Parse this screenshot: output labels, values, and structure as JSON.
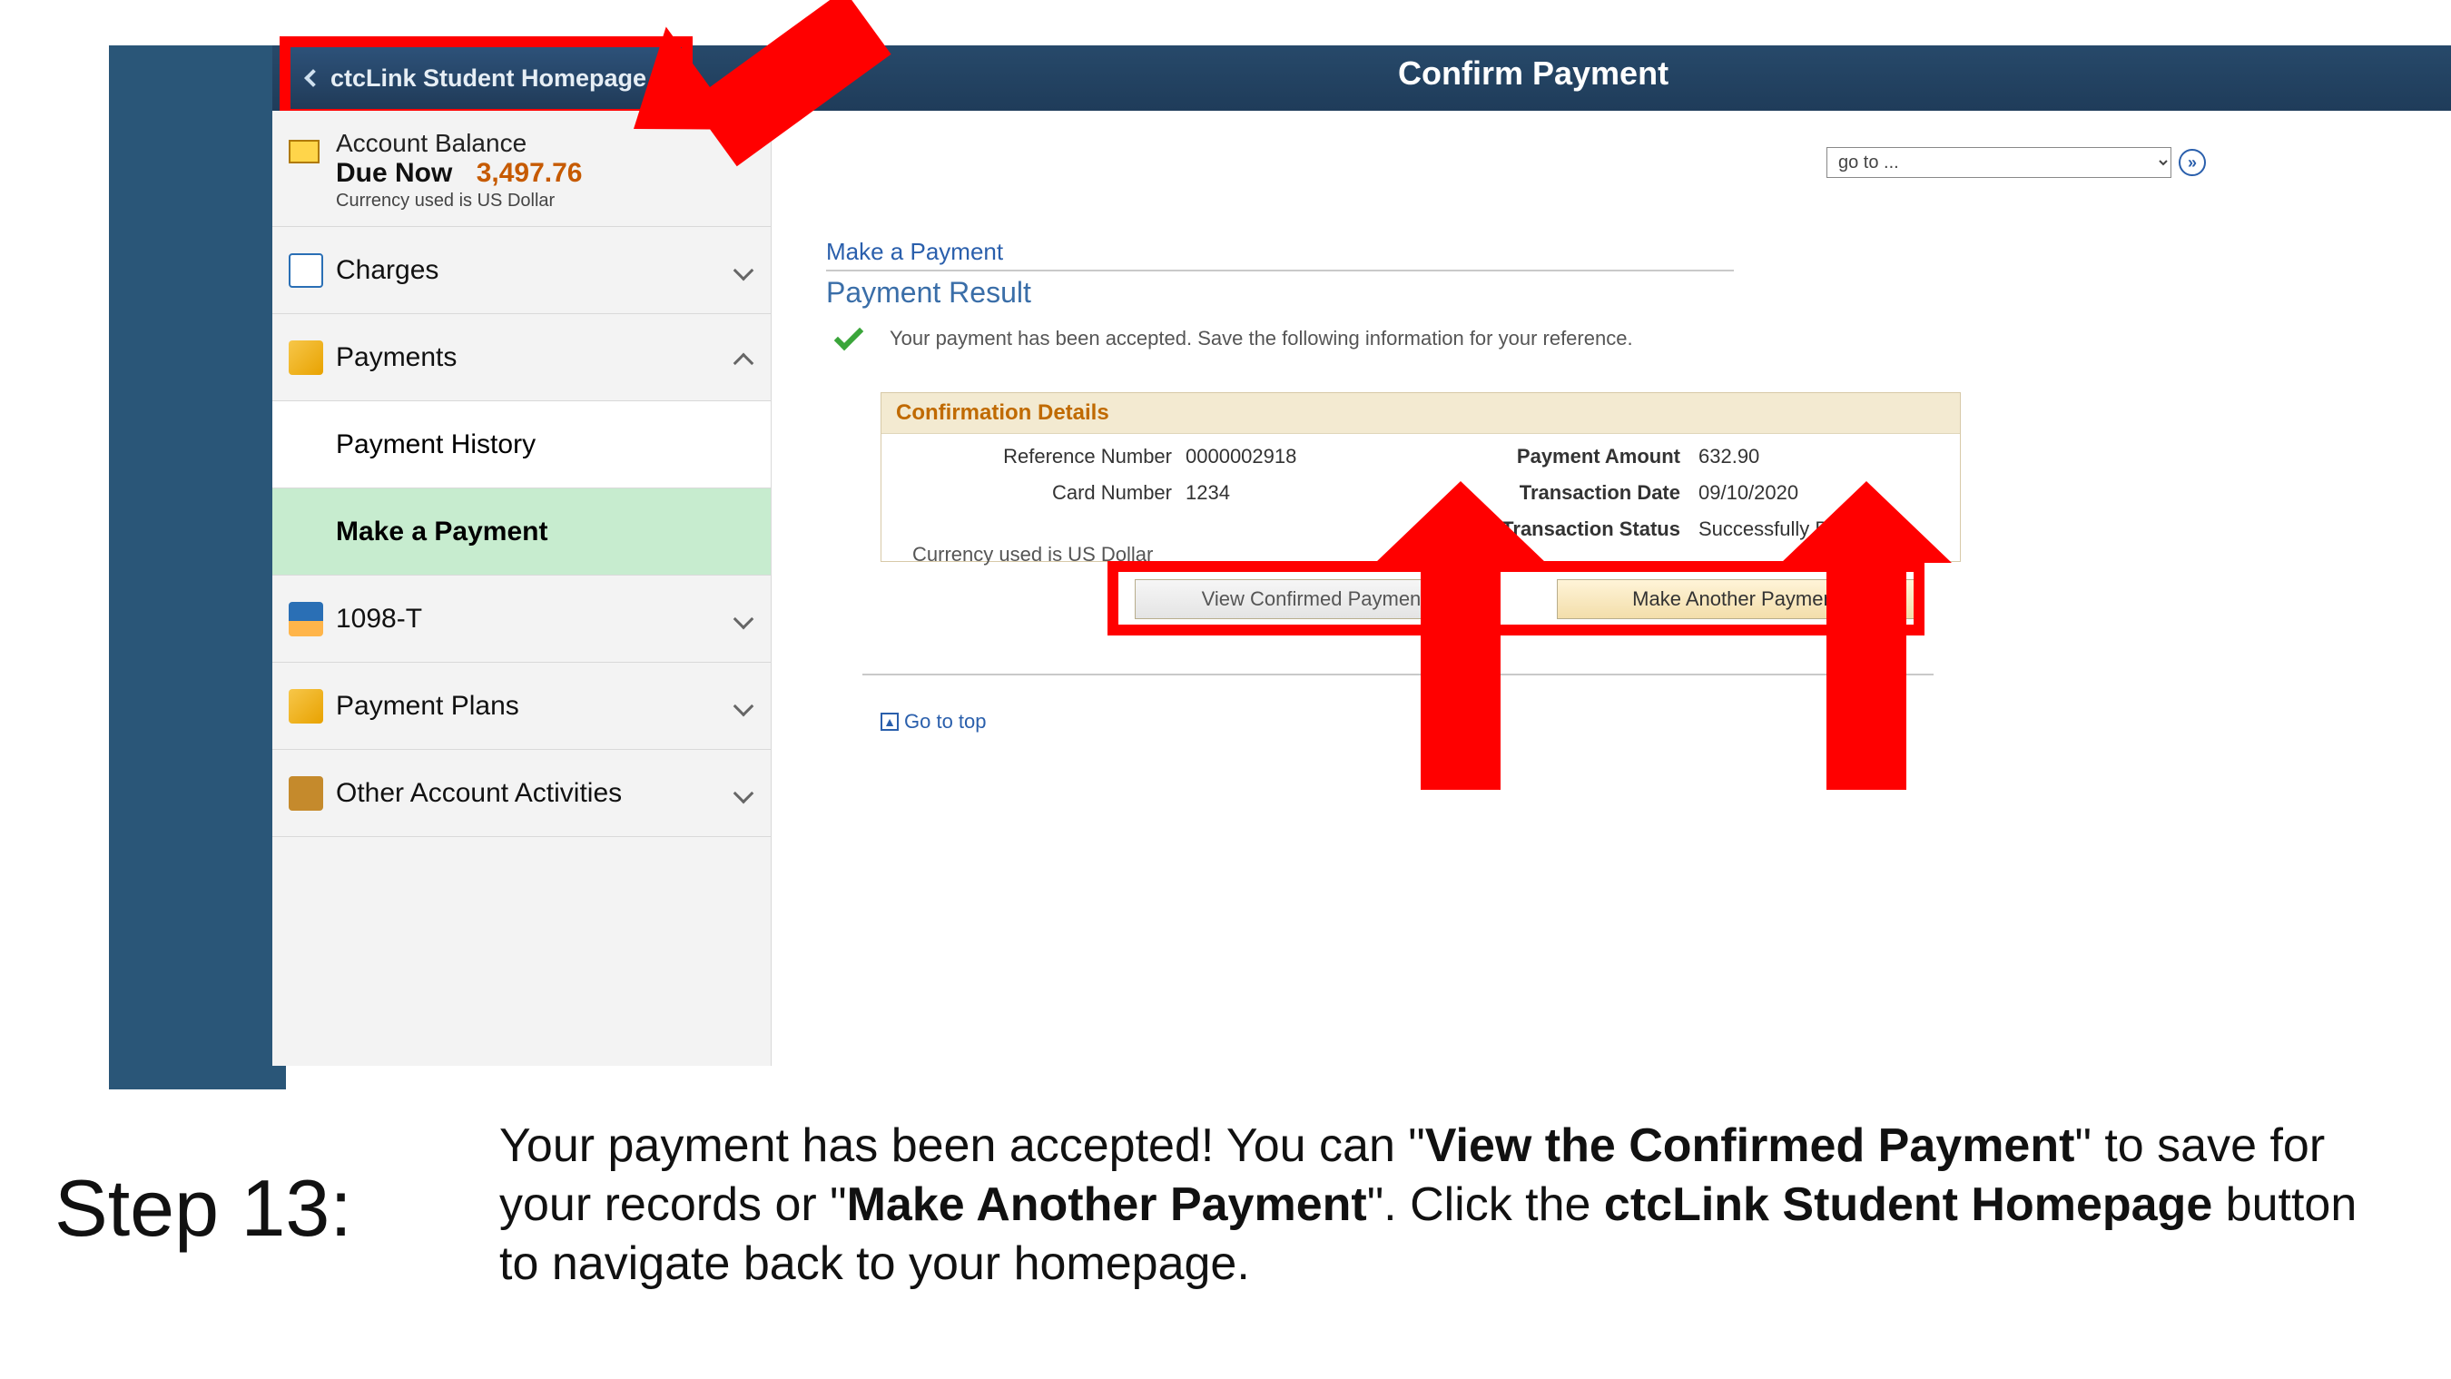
{
  "header": {
    "back_label": "ctcLink Student Homepage",
    "title": "Confirm Payment"
  },
  "sidebar": {
    "balance_heading": "Account Balance",
    "due_label": "Due Now",
    "due_amount": "3,497.76",
    "currency_note": "Currency used is US Dollar",
    "charges": "Charges",
    "payments": "Payments",
    "payment_history": "Payment History",
    "make_payment": "Make a Payment",
    "t1098": "1098-T",
    "plans": "Payment Plans",
    "other": "Other Account Activities"
  },
  "goto": {
    "placeholder": "go to ...",
    "go_glyph": "»"
  },
  "content": {
    "crumb": "Make a Payment",
    "section": "Payment Result",
    "accepted_msg": "Your payment has been accepted. Save the following information for your reference.",
    "panel_title": "Confirmation Details",
    "ref_label": "Reference Number",
    "ref_value": "0000002918",
    "card_label": "Card Number",
    "card_value": "1234",
    "amount_label": "Payment Amount",
    "amount_value": "632.90",
    "date_label": "Transaction Date",
    "date_value": "09/10/2020",
    "status_label": "Transaction Status",
    "status_value": "Successfully Posted",
    "currency_note": "Currency used is US Dollar",
    "btn_view": "View Confirmed Payment",
    "btn_again": "Make Another Payment",
    "go_top": "Go to top"
  },
  "caption": {
    "step": "Step 13:",
    "t1": "Your payment has been accepted! You can \"",
    "b1": "View the Confirmed Payment",
    "t2": "\" to save for your records or \"",
    "b2": "Make Another Payment",
    "t3": "\". Click the ",
    "b3": "ctcLink Student Homepage",
    "t4": " button to navigate back to your homepage."
  }
}
